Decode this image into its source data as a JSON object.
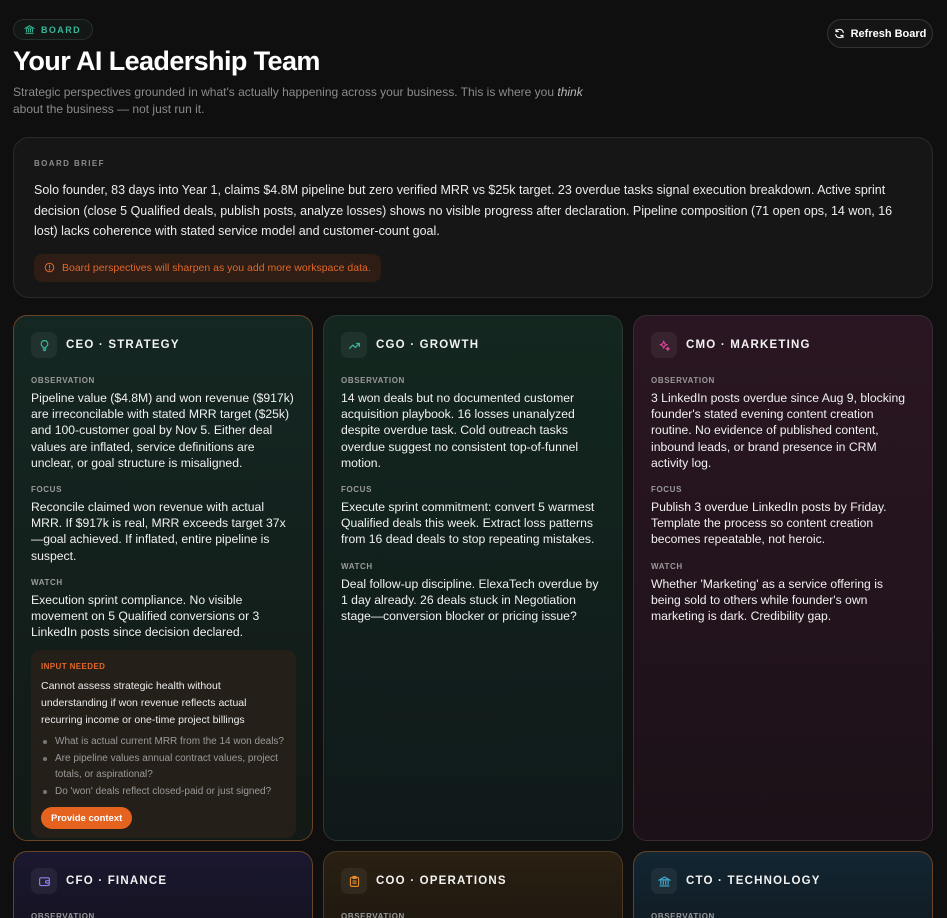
{
  "header": {
    "badge": "BOARD",
    "title": "Your AI Leadership Team",
    "subtitle_before": "Strategic perspectives grounded in what's actually happening across your business. This is where you ",
    "subtitle_em": "think",
    "subtitle_after": " about the business — not just run it.",
    "refresh_label": "Refresh Board"
  },
  "brief": {
    "label": "BOARD BRIEF",
    "text": "Solo founder, 83 days into Year 1, claims $4.8M pipeline but zero verified MRR vs $25k target. 23 overdue tasks signal execution breakdown. Active sprint decision (close 5 Qualified deals, publish posts, analyze losses) shows no visible progress after declaration. Pipeline composition (71 open ops, 14 won, 16 lost) lacks coherence with stated service model and customer-count goal.",
    "warning": "Board perspectives will sharpen as you add more workspace data."
  },
  "labels": {
    "observation": "OBSERVATION",
    "focus": "FOCUS",
    "watch": "WATCH"
  },
  "colors": {
    "accent_orange": "#e5631f",
    "accent_teal": "#37b89a",
    "accent_pink": "#e0449a",
    "accent_purple": "#8a7ff0",
    "accent_amber": "#e08a2a",
    "accent_blue": "#3fb0d8"
  },
  "cards": {
    "ceo": {
      "title": "CEO · STRATEGY",
      "icon": "lightbulb-icon",
      "observation": "Pipeline value ($4.8M) and won revenue ($917k) are irreconcilable with stated MRR target ($25k) and 100-customer goal by Nov 5. Either deal values are inflated, service definitions are unclear, or goal structure is misaligned.",
      "focus": "Reconcile claimed won revenue with actual MRR. If $917k is real, MRR exceeds target 37x—goal achieved. If inflated, entire pipeline is suspect.",
      "watch": "Execution sprint compliance. No visible movement on 5 Qualified conversions or 3 LinkedIn posts since decision declared.",
      "input": {
        "label": "INPUT NEEDED",
        "text": "Cannot assess strategic health without understanding if won revenue reflects actual recurring income or one-time project billings",
        "questions": [
          "What is actual current MRR from the 14 won deals?",
          "Are pipeline values annual contract values, project totals, or aspirational?",
          "Do 'won' deals reflect closed-paid or just signed?"
        ],
        "button": "Provide context"
      }
    },
    "cgo": {
      "title": "CGO · GROWTH",
      "icon": "trending-up-icon",
      "observation": "14 won deals but no documented customer acquisition playbook. 16 losses unanalyzed despite overdue task. Cold outreach tasks overdue suggest no consistent top-of-funnel motion.",
      "focus": "Execute sprint commitment: convert 5 warmest Qualified deals this week. Extract loss patterns from 16 dead deals to stop repeating mistakes.",
      "watch": "Deal follow-up discipline. ElexaTech overdue by 1 day already. 26 deals stuck in Negotiation stage—conversion blocker or pricing issue?"
    },
    "cmo": {
      "title": "CMO · MARKETING",
      "icon": "sparkles-icon",
      "observation": "3 LinkedIn posts overdue since Aug 9, blocking founder's stated evening content creation routine. No evidence of published content, inbound leads, or brand presence in CRM activity log.",
      "focus": "Publish 3 overdue LinkedIn posts by Friday. Template the process so content creation becomes repeatable, not heroic.",
      "watch": "Whether 'Marketing' as a service offering is being sold to others while founder's own marketing is dark. Credibility gap."
    },
    "cfo": {
      "title": "CFO · FINANCE",
      "icon": "wallet-icon"
    },
    "coo": {
      "title": "COO · OPERATIONS",
      "icon": "clipboard-icon"
    },
    "cto": {
      "title": "CTO · TECHNOLOGY",
      "icon": "building-icon"
    }
  }
}
